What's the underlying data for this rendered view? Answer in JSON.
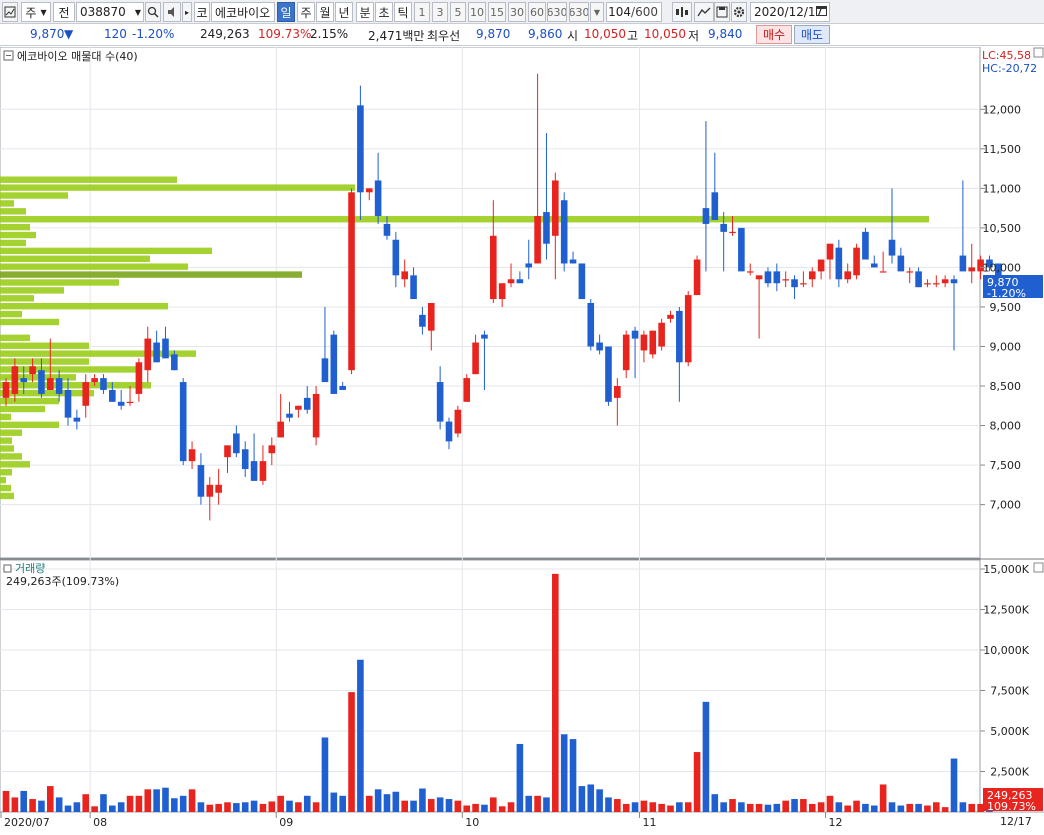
{
  "toolbar": {
    "market": "주",
    "kind": "전",
    "code": "038870",
    "code_type": "코",
    "name": "에코바이오",
    "periods": [
      "일",
      "주",
      "월",
      "년",
      "분",
      "초",
      "틱"
    ],
    "active_period": "일",
    "minutes": [
      "1",
      "3",
      "5",
      "10",
      "15",
      "30",
      "60",
      "630",
      "630"
    ],
    "count": "104",
    "count_total": "/600",
    "date": "2020/12/17"
  },
  "quote": {
    "price": "9,870",
    "arrow": "▼",
    "change": "120",
    "change_pct": "-1.20%",
    "volume": "249,263",
    "volume_ratio": "109.73%",
    "turnover": "2.15%",
    "amount": "2,471백만",
    "bid_label": "최우선",
    "bid1": "9,870",
    "bid2": "9,860",
    "open_label": "시",
    "open": "10,050",
    "high_label": "고",
    "high": "10,050",
    "low_label": "저",
    "low": "9,840",
    "buy_label": "매수",
    "sell_label": "매도"
  },
  "price_panel": {
    "title": "에코바이오 매물대 수(40)",
    "lc": "LC:45,58",
    "hc": "HC:-20,72",
    "cur_price": "9,870",
    "cur_pct": "-1.20%",
    "y_ticks": [
      "12,000",
      "11,500",
      "11,000",
      "10,500",
      "10,000",
      "9,500",
      "9,000",
      "8,500",
      "8,000",
      "7,500",
      "7,000"
    ]
  },
  "volume_panel": {
    "title": "거래량",
    "subtitle": "249,263주(109.73%)",
    "cur_vol": "249,263",
    "cur_pct": "109.73%",
    "y_ticks": [
      "15,000K",
      "12,500K",
      "10,000K",
      "7,500K",
      "5,000K",
      "2,500K"
    ]
  },
  "x_axis": {
    "labels": [
      "2020/07",
      "08",
      "09",
      "10",
      "11",
      "12"
    ],
    "end_label": "12/17"
  },
  "colors": {
    "up": "#e8241e",
    "down": "#1f5fd0",
    "profile": "#9acd1a",
    "profile_max": "#7aa41b"
  },
  "chart_data": {
    "type": "candlestick",
    "candles": [
      {
        "o": 8350,
        "h": 8600,
        "l": 8250,
        "c": 8550
      },
      {
        "o": 8400,
        "h": 8850,
        "l": 8300,
        "c": 8750
      },
      {
        "o": 8600,
        "h": 8750,
        "l": 8400,
        "c": 8550
      },
      {
        "o": 8650,
        "h": 8850,
        "l": 8550,
        "c": 8750
      },
      {
        "o": 8700,
        "h": 8850,
        "l": 8350,
        "c": 8400
      },
      {
        "o": 8450,
        "h": 9100,
        "l": 8450,
        "c": 8600
      },
      {
        "o": 8600,
        "h": 8700,
        "l": 8300,
        "c": 8400
      },
      {
        "o": 8450,
        "h": 8600,
        "l": 8000,
        "c": 8100
      },
      {
        "o": 8100,
        "h": 8200,
        "l": 7950,
        "c": 8050
      },
      {
        "o": 8250,
        "h": 8650,
        "l": 8100,
        "c": 8550
      },
      {
        "o": 8550,
        "h": 8650,
        "l": 8500,
        "c": 8600
      },
      {
        "o": 8600,
        "h": 8650,
        "l": 8400,
        "c": 8450
      },
      {
        "o": 8450,
        "h": 8550,
        "l": 8300,
        "c": 8300
      },
      {
        "o": 8300,
        "h": 8450,
        "l": 8200,
        "c": 8250
      },
      {
        "o": 8300,
        "h": 8500,
        "l": 8250,
        "c": 8300
      },
      {
        "o": 8400,
        "h": 8850,
        "l": 8300,
        "c": 8800
      },
      {
        "o": 8700,
        "h": 9250,
        "l": 8550,
        "c": 9100
      },
      {
        "o": 9050,
        "h": 9200,
        "l": 8800,
        "c": 8800
      },
      {
        "o": 9100,
        "h": 9250,
        "l": 8850,
        "c": 8850
      },
      {
        "o": 8900,
        "h": 8950,
        "l": 8700,
        "c": 8700
      },
      {
        "o": 8550,
        "h": 8600,
        "l": 7500,
        "c": 7550
      },
      {
        "o": 7550,
        "h": 7800,
        "l": 7450,
        "c": 7700
      },
      {
        "o": 7500,
        "h": 7650,
        "l": 7000,
        "c": 7100
      },
      {
        "o": 7100,
        "h": 7350,
        "l": 6800,
        "c": 7250
      },
      {
        "o": 7150,
        "h": 7450,
        "l": 7000,
        "c": 7250
      },
      {
        "o": 7600,
        "h": 7750,
        "l": 7400,
        "c": 7750
      },
      {
        "o": 7900,
        "h": 8000,
        "l": 7600,
        "c": 7650
      },
      {
        "o": 7700,
        "h": 7800,
        "l": 7350,
        "c": 7450
      },
      {
        "o": 7550,
        "h": 7900,
        "l": 7300,
        "c": 7300
      },
      {
        "o": 7300,
        "h": 7750,
        "l": 7250,
        "c": 7550
      },
      {
        "o": 7650,
        "h": 7850,
        "l": 7500,
        "c": 7750
      },
      {
        "o": 7850,
        "h": 8400,
        "l": 7850,
        "c": 8050
      },
      {
        "o": 8150,
        "h": 8300,
        "l": 8050,
        "c": 8100
      },
      {
        "o": 8200,
        "h": 8250,
        "l": 8100,
        "c": 8250
      },
      {
        "o": 8350,
        "h": 8500,
        "l": 8150,
        "c": 8200
      },
      {
        "o": 7850,
        "h": 8500,
        "l": 7750,
        "c": 8400
      },
      {
        "o": 8850,
        "h": 9500,
        "l": 8550,
        "c": 8550
      },
      {
        "o": 9150,
        "h": 9200,
        "l": 8400,
        "c": 8400
      },
      {
        "o": 8500,
        "h": 8550,
        "l": 8450,
        "c": 8450
      },
      {
        "o": 8700,
        "h": 11000,
        "l": 8650,
        "c": 10950
      },
      {
        "o": 12050,
        "h": 12300,
        "l": 10600,
        "c": 10950
      },
      {
        "o": 10950,
        "h": 11000,
        "l": 10850,
        "c": 11000
      },
      {
        "o": 11100,
        "h": 11450,
        "l": 10550,
        "c": 10650
      },
      {
        "o": 10550,
        "h": 10650,
        "l": 10350,
        "c": 10400
      },
      {
        "o": 10350,
        "h": 10450,
        "l": 9750,
        "c": 9900
      },
      {
        "o": 9850,
        "h": 10100,
        "l": 9750,
        "c": 9950
      },
      {
        "o": 9900,
        "h": 10000,
        "l": 9600,
        "c": 9600
      },
      {
        "o": 9400,
        "h": 9500,
        "l": 9150,
        "c": 9250
      },
      {
        "o": 9200,
        "h": 9550,
        "l": 8950,
        "c": 9550
      },
      {
        "o": 8550,
        "h": 8750,
        "l": 7950,
        "c": 8050
      },
      {
        "o": 8050,
        "h": 8100,
        "l": 7700,
        "c": 7800
      },
      {
        "o": 7900,
        "h": 8250,
        "l": 7850,
        "c": 8200
      },
      {
        "o": 8300,
        "h": 8650,
        "l": 8300,
        "c": 8600
      },
      {
        "o": 8650,
        "h": 9150,
        "l": 8650,
        "c": 9050
      },
      {
        "o": 9150,
        "h": 9200,
        "l": 8450,
        "c": 9100
      },
      {
        "o": 9600,
        "h": 10850,
        "l": 9550,
        "c": 10400
      },
      {
        "o": 9600,
        "h": 9650,
        "l": 9500,
        "c": 9800
      },
      {
        "o": 9800,
        "h": 10050,
        "l": 9750,
        "c": 9850
      },
      {
        "o": 9850,
        "h": 9950,
        "l": 9800,
        "c": 9800
      },
      {
        "o": 10050,
        "h": 10350,
        "l": 9850,
        "c": 10000
      },
      {
        "o": 10050,
        "h": 12450,
        "l": 10050,
        "c": 10650
      },
      {
        "o": 10700,
        "h": 11700,
        "l": 10100,
        "c": 10300
      },
      {
        "o": 10400,
        "h": 11200,
        "l": 9850,
        "c": 11100
      },
      {
        "o": 10850,
        "h": 10950,
        "l": 9950,
        "c": 10050
      },
      {
        "o": 10100,
        "h": 10200,
        "l": 10050,
        "c": 10050
      },
      {
        "o": 10050,
        "h": 10050,
        "l": 9600,
        "c": 9600
      },
      {
        "o": 9550,
        "h": 9600,
        "l": 8950,
        "c": 9000
      },
      {
        "o": 9050,
        "h": 9150,
        "l": 8900,
        "c": 8950
      },
      {
        "o": 9000,
        "h": 9000,
        "l": 8250,
        "c": 8300
      },
      {
        "o": 8350,
        "h": 8600,
        "l": 8000,
        "c": 8500
      },
      {
        "o": 8700,
        "h": 9200,
        "l": 8600,
        "c": 9150
      },
      {
        "o": 9200,
        "h": 9250,
        "l": 8600,
        "c": 9100
      },
      {
        "o": 8950,
        "h": 9200,
        "l": 8800,
        "c": 9150
      },
      {
        "o": 8900,
        "h": 9200,
        "l": 8850,
        "c": 9200
      },
      {
        "o": 9000,
        "h": 9350,
        "l": 8950,
        "c": 9300
      },
      {
        "o": 9350,
        "h": 9450,
        "l": 9300,
        "c": 9400
      },
      {
        "o": 9450,
        "h": 9500,
        "l": 8300,
        "c": 8800
      },
      {
        "o": 8800,
        "h": 9700,
        "l": 8750,
        "c": 9650
      },
      {
        "o": 9650,
        "h": 10150,
        "l": 9650,
        "c": 10100
      },
      {
        "o": 10750,
        "h": 11850,
        "l": 9950,
        "c": 10550
      },
      {
        "o": 10950,
        "h": 11450,
        "l": 10600,
        "c": 10600
      },
      {
        "o": 10550,
        "h": 10700,
        "l": 9950,
        "c": 10450
      },
      {
        "o": 10450,
        "h": 10650,
        "l": 10400,
        "c": 10450
      },
      {
        "o": 10500,
        "h": 10500,
        "l": 9950,
        "c": 9950
      },
      {
        "o": 9950,
        "h": 10050,
        "l": 9900,
        "c": 9950
      },
      {
        "o": 9850,
        "h": 9900,
        "l": 9100,
        "c": 9900
      },
      {
        "o": 9950,
        "h": 10000,
        "l": 9750,
        "c": 9800
      },
      {
        "o": 9950,
        "h": 10050,
        "l": 9700,
        "c": 9800
      },
      {
        "o": 9850,
        "h": 9950,
        "l": 9750,
        "c": 9850
      },
      {
        "o": 9850,
        "h": 9900,
        "l": 9600,
        "c": 9750
      },
      {
        "o": 9800,
        "h": 9950,
        "l": 9750,
        "c": 9800
      },
      {
        "o": 9850,
        "h": 10000,
        "l": 9750,
        "c": 9950
      },
      {
        "o": 9950,
        "h": 10050,
        "l": 9850,
        "c": 10100
      },
      {
        "o": 10100,
        "h": 10300,
        "l": 9850,
        "c": 10300
      },
      {
        "o": 10250,
        "h": 10350,
        "l": 9750,
        "c": 9850
      },
      {
        "o": 9850,
        "h": 10050,
        "l": 9800,
        "c": 9950
      },
      {
        "o": 9900,
        "h": 10300,
        "l": 9850,
        "c": 10250
      },
      {
        "o": 10450,
        "h": 10500,
        "l": 10100,
        "c": 10100
      },
      {
        "o": 10050,
        "h": 10150,
        "l": 10000,
        "c": 10000
      },
      {
        "o": 9950,
        "h": 10200,
        "l": 9950,
        "c": 9950
      },
      {
        "o": 10350,
        "h": 11000,
        "l": 10050,
        "c": 10150
      },
      {
        "o": 10150,
        "h": 10250,
        "l": 9950,
        "c": 9950
      },
      {
        "o": 9950,
        "h": 10000,
        "l": 9800,
        "c": 9950
      },
      {
        "o": 9950,
        "h": 10000,
        "l": 9750,
        "c": 9750
      },
      {
        "o": 9800,
        "h": 9850,
        "l": 9750,
        "c": 9800
      },
      {
        "o": 9800,
        "h": 9900,
        "l": 9750,
        "c": 9800
      },
      {
        "o": 9800,
        "h": 9900,
        "l": 9750,
        "c": 9850
      },
      {
        "o": 9850,
        "h": 9900,
        "l": 8950,
        "c": 9800
      },
      {
        "o": 10150,
        "h": 11100,
        "l": 9950,
        "c": 9950
      },
      {
        "o": 9950,
        "h": 10300,
        "l": 9800,
        "c": 10000
      },
      {
        "o": 9950,
        "h": 10150,
        "l": 9850,
        "c": 10100
      },
      {
        "o": 10100,
        "h": 10150,
        "l": 9950,
        "c": 10000
      },
      {
        "o": 10050,
        "h": 10050,
        "l": 9840,
        "c": 9870
      }
    ],
    "volume": [
      1300,
      900,
      1300,
      800,
      700,
      1600,
      900,
      400,
      600,
      1100,
      350,
      1100,
      400,
      600,
      1000,
      1000,
      1400,
      1400,
      1500,
      850,
      1000,
      1400,
      600,
      450,
      500,
      600,
      550,
      600,
      700,
      500,
      650,
      1000,
      700,
      600,
      1000,
      600,
      4600,
      1200,
      1000,
      7400,
      9400,
      1000,
      1400,
      1100,
      1250,
      700,
      700,
      1450,
      800,
      900,
      800,
      700,
      400,
      500,
      450,
      900,
      350,
      600,
      4200,
      1000,
      1000,
      900,
      14700,
      4800,
      4500,
      1600,
      1700,
      1400,
      900,
      800,
      500,
      600,
      700,
      600,
      500,
      400,
      600,
      600,
      3700,
      6800,
      1100,
      600,
      800,
      600,
      500,
      500,
      450,
      500,
      700,
      800,
      800,
      500,
      600,
      1000,
      600,
      400,
      700,
      500,
      400,
      1700,
      600,
      400,
      500,
      500,
      400,
      600,
      300,
      3300,
      600,
      500,
      500,
      249
    ]
  },
  "volume_profile": [
    {
      "p": 11100,
      "w": 177
    },
    {
      "p": 11000,
      "w": 355
    },
    {
      "p": 10900,
      "w": 68
    },
    {
      "p": 10800,
      "w": 14
    },
    {
      "p": 10700,
      "w": 26
    },
    {
      "p": 10600,
      "w": 929
    },
    {
      "p": 10500,
      "w": 30
    },
    {
      "p": 10400,
      "w": 36
    },
    {
      "p": 10300,
      "w": 26
    },
    {
      "p": 10200,
      "w": 212
    },
    {
      "p": 10100,
      "w": 150
    },
    {
      "p": 10000,
      "w": 188
    },
    {
      "p": 9900,
      "w": 302
    },
    {
      "p": 9800,
      "w": 119
    },
    {
      "p": 9700,
      "w": 64
    },
    {
      "p": 9600,
      "w": 34
    },
    {
      "p": 9500,
      "w": 168
    },
    {
      "p": 9400,
      "w": 22
    },
    {
      "p": 9300,
      "w": 59
    },
    {
      "p": 9200,
      "w": 0
    },
    {
      "p": 9100,
      "w": 30
    },
    {
      "p": 9000,
      "w": 89
    },
    {
      "p": 8900,
      "w": 196
    },
    {
      "p": 8800,
      "w": 89
    },
    {
      "p": 8700,
      "w": 136
    },
    {
      "p": 8600,
      "w": 76
    },
    {
      "p": 8500,
      "w": 151
    },
    {
      "p": 8400,
      "w": 94
    },
    {
      "p": 8300,
      "w": 59
    },
    {
      "p": 8200,
      "w": 45
    },
    {
      "p": 8100,
      "w": 11
    },
    {
      "p": 8000,
      "w": 59
    },
    {
      "p": 7900,
      "w": 22
    },
    {
      "p": 7800,
      "w": 12
    },
    {
      "p": 7700,
      "w": 14
    },
    {
      "p": 7600,
      "w": 22
    },
    {
      "p": 7500,
      "w": 30
    },
    {
      "p": 7400,
      "w": 12
    },
    {
      "p": 7300,
      "w": 6
    },
    {
      "p": 7200,
      "w": 11
    },
    {
      "p": 7100,
      "w": 14
    }
  ],
  "price_range": {
    "min": 6350,
    "max": 12750
  },
  "volume_range": {
    "min": 0,
    "max": 15000
  }
}
